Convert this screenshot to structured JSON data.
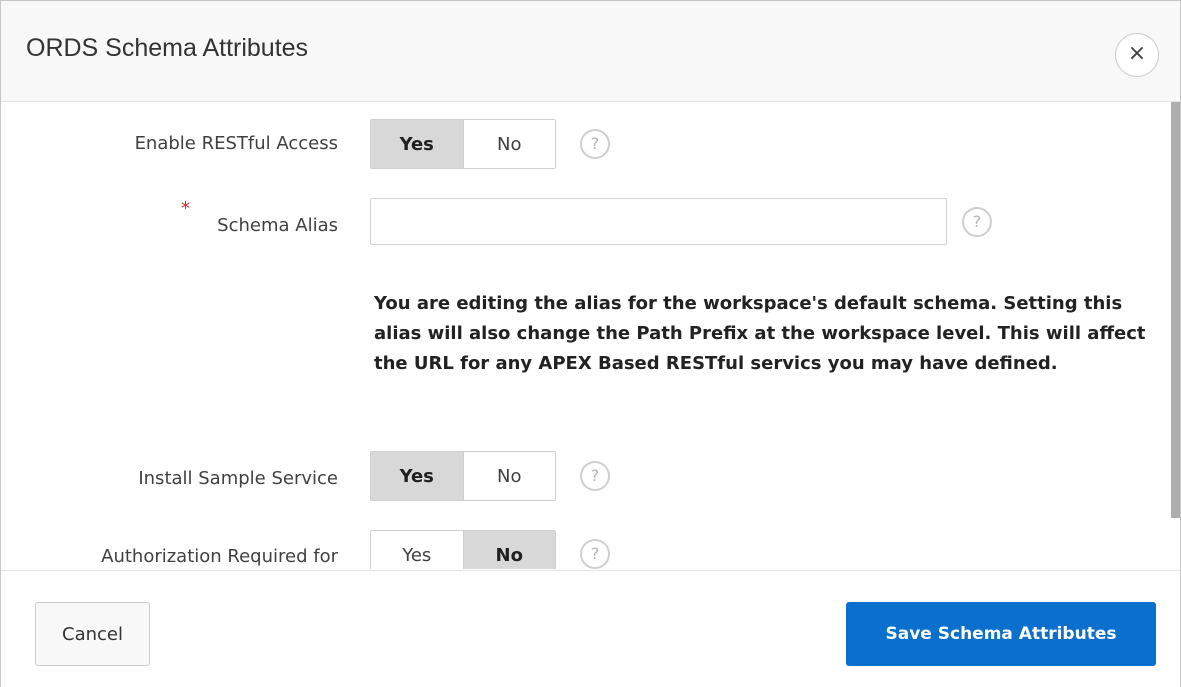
{
  "dialog": {
    "title": "ORDS Schema Attributes",
    "close_icon": "close-icon"
  },
  "form": {
    "enable_restful": {
      "label": "Enable RESTful Access",
      "yes": "Yes",
      "no": "No",
      "selected": "Yes",
      "help": "?"
    },
    "schema_alias": {
      "required_mark": "*",
      "label": "Schema Alias",
      "value": "",
      "placeholder": "",
      "help": "?"
    },
    "warning": "You are editing the alias for the workspace's default schema. Setting this alias will also change the Path Prefix at the workspace level. This will affect the URL for any APEX Based RESTful servics you may have defined.",
    "install_sample": {
      "label": "Install Sample Service",
      "yes": "Yes",
      "no": "No",
      "selected": "Yes",
      "help": "?"
    },
    "auth_required": {
      "label": "Authorization Required for",
      "yes": "Yes",
      "no": "No",
      "selected": "No",
      "help": "?"
    }
  },
  "footer": {
    "cancel_label": "Cancel",
    "save_label": "Save Schema Attributes"
  },
  "colors": {
    "primary": "#0b6fce",
    "required": "#e02020",
    "toggle_selected": "#d8d8d8"
  }
}
